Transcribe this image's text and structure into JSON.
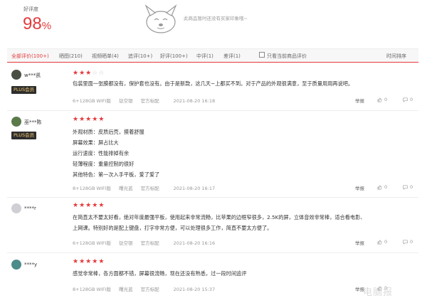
{
  "summary": {
    "rate_label": "好评度",
    "rate_value": "98",
    "rate_unit": "%",
    "no_impression": "此商品暂时还没有买家印象哦~"
  },
  "tabs": {
    "all": "全部评价(100+)",
    "pictures": "晒图(210)",
    "video": "视频晒单(4)",
    "append": "追评(10+)",
    "good": "好评(100+)",
    "medium": "中评(1)",
    "bad": "差评(1)",
    "current_only": "只看当前商品评价",
    "sort": "时间排序"
  },
  "reviews": [
    {
      "user": "w***凯",
      "badge": "PLUS会员",
      "rating": 3,
      "lines": [
        "包装里面一张膜都没有，保护套也没有。由于是新款，这几天~上都买不到。对于产品的外观很满意，至于质量用用再说吧。"
      ],
      "spec": "6+128GB WIFI版",
      "color": "钛空银",
      "store": "官方标配",
      "date": "2021-08-20 16:18",
      "report": "举报",
      "likes": "0",
      "replies": "0"
    },
    {
      "user": "巫***陈",
      "badge": "PLUS会员",
      "rating": 5,
      "lines": [
        "外观材质：皮质后壳，摸着舒服",
        "屏幕效果：屏占比大",
        "运行速度：性能排掉有余",
        "轻薄程度：重量控制的很好",
        "其他特色：第一次入手平板，爱了爱了"
      ],
      "spec": "8+128GB WIFI版",
      "color": "曙光蓝",
      "store": "官方标配",
      "date": "2021-08-20 16:17",
      "report": "举报",
      "likes": "0",
      "replies": "0"
    },
    {
      "user": "****r",
      "badge": "",
      "rating": 5,
      "lines": [
        "在简直太不要太好看，绝对年度最强平板，使用起来非常流畅，比苹果的边框窄很多，2.5K的屏，立体音效非常棒，适合看电影、",
        "上网课。特别好的是配上键盘，打字非常方便，可以处理很多工作，简直不要太方便了。"
      ],
      "spec": "6+128GB WIFI版",
      "color": "钛空银",
      "store": "官方标配",
      "date": "2021-08-20 16:16",
      "report": "举报",
      "likes": "0",
      "replies": "0"
    },
    {
      "user": "****y",
      "badge": "",
      "rating": 5,
      "lines": [
        "感觉非常棒，各方面都不错，屏幕很流畅，现在还没有熟悉，过一段时间追评"
      ],
      "spec": "8+128GB WIFI版",
      "color": "曙光蓝",
      "store": "官方标配",
      "date": "2021-08-20 15:37",
      "report": "举报",
      "likes": "0",
      "replies": "0"
    }
  ],
  "watermark": "电脑报",
  "colors": {
    "accent": "#e4393c",
    "plus_bg": "#2e2e2e",
    "plus_text": "#f2c66d"
  }
}
